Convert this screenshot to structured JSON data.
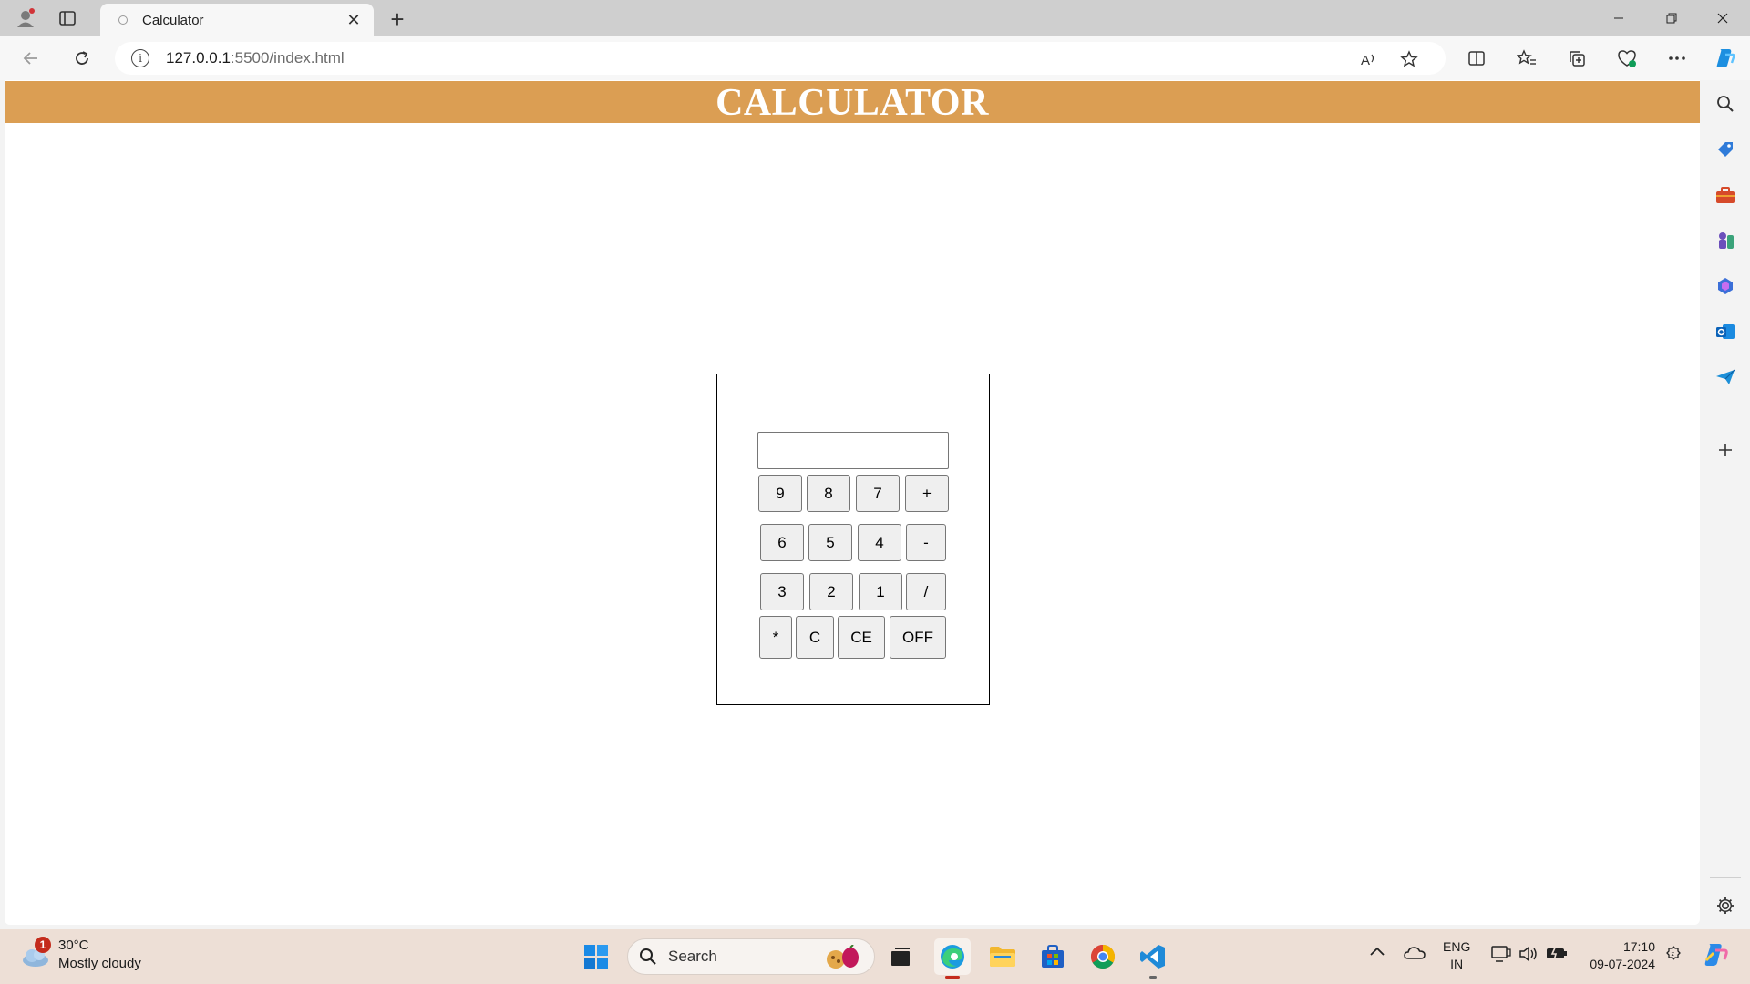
{
  "browser": {
    "tab_title": "Calculator",
    "url_host": "127.0.0.1",
    "url_path": ":5500/index.html"
  },
  "page": {
    "heading": "CALCULATOR",
    "header_color": "#db9e53",
    "display_value": "",
    "rows": [
      [
        "9",
        "8",
        "7",
        "+"
      ],
      [
        "6",
        "5",
        "4",
        "-"
      ],
      [
        "3",
        "2",
        "1",
        "/"
      ],
      [
        "*",
        "C",
        "CE",
        "OFF"
      ]
    ]
  },
  "taskbar": {
    "weather_temp": "30°C",
    "weather_desc": "Mostly cloudy",
    "weather_badge": "1",
    "search_label": "Search",
    "lang_top": "ENG",
    "lang_bottom": "IN",
    "time": "17:10",
    "date": "09-07-2024"
  }
}
